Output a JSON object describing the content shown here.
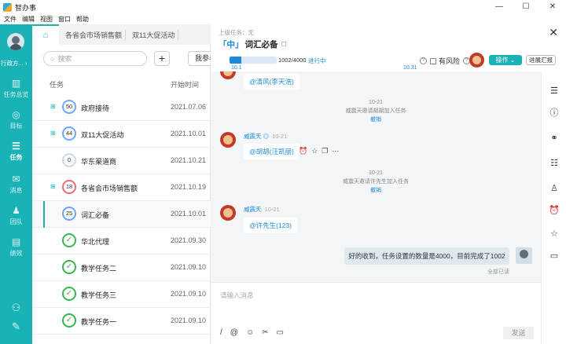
{
  "app": {
    "name": "智办事",
    "window_controls": [
      "—",
      "☐",
      "✕"
    ]
  },
  "menu": [
    "文件",
    "编辑",
    "视图",
    "窗口",
    "帮助"
  ],
  "user": {
    "name": "行政方..."
  },
  "nav": [
    {
      "label": "任务总览",
      "icon": "▥"
    },
    {
      "label": "目标",
      "icon": "◎"
    },
    {
      "label": "任务",
      "icon": "☰"
    },
    {
      "label": "消息",
      "icon": "✉"
    },
    {
      "label": "团队",
      "icon": "♟"
    },
    {
      "label": "绩效",
      "icon": "▤"
    }
  ],
  "nav_bottom": [
    {
      "icon": "⚇"
    },
    {
      "icon": "✎"
    }
  ],
  "tabs": [
    "各省会市场销售额",
    "双11大促活动"
  ],
  "search": {
    "placeholder": "搜索",
    "add": "+",
    "mine": "我参与"
  },
  "columns": {
    "task": "任务",
    "start": "开始时间"
  },
  "tasks": [
    {
      "name": "政府接待",
      "progress": "50",
      "date": "2021.07.06",
      "sub": true,
      "kind": "blue"
    },
    {
      "name": "双11大促活动",
      "progress": "44",
      "date": "2021.10.01",
      "sub": true,
      "kind": "blue"
    },
    {
      "name": "华东渠道商",
      "progress": "0",
      "date": "2021.10.21",
      "sub": false,
      "kind": "zero"
    },
    {
      "name": "各省会市场销售额",
      "progress": "18",
      "date": "2021.10.19",
      "sub": true,
      "kind": "red"
    },
    {
      "name": "词汇必备",
      "progress": "25",
      "date": "2021.10.01",
      "sub": false,
      "kind": "blue",
      "selected": true
    },
    {
      "name": "华北代理",
      "progress": "✓",
      "date": "2021.09.30",
      "sub": false,
      "kind": "done"
    },
    {
      "name": "教学任务二",
      "progress": "✓",
      "date": "2021.09.10",
      "sub": false,
      "kind": "done"
    },
    {
      "name": "教学任务三",
      "progress": "✓",
      "date": "2021.09.10",
      "sub": false,
      "kind": "done"
    },
    {
      "name": "教学任务一",
      "progress": "✓",
      "date": "2021.09.10",
      "sub": false,
      "kind": "done"
    }
  ],
  "detail": {
    "parent": "上级任务：无",
    "priority": "「中」",
    "title": "词汇必备",
    "progress_text": "1002/4000",
    "progress_value": 0.25,
    "status": "进行中",
    "start": "10.1",
    "end": "10.31",
    "risk": "有风险",
    "operate": "操作 ⌄",
    "report": "进展汇报"
  },
  "chat": {
    "m1": "@清风(李天浩)",
    "s1": {
      "date": "10-21",
      "text": "威震天邀请胡胡加入任务",
      "undo": "撤销"
    },
    "m2_name": "威震天 ◎",
    "m2_time": "10-21",
    "m2": "@胡胡(汪凯丽)",
    "m2_tools": "⏰☆❐⋯",
    "s2": {
      "date": "10-21",
      "text": "威震天邀请许先生加入任务",
      "undo": "撤销"
    },
    "m3_name": "威震天",
    "m3_time": "10-21",
    "m3": "@许先生(123)",
    "mine": "好的收到，任务设置的数量是4000，目前完成了1002",
    "read": "全部已读",
    "placeholder": "请输入消息",
    "tools": [
      "/",
      "@",
      "☺",
      "✂",
      "▭"
    ],
    "send": "发送"
  },
  "rail": [
    "☰",
    "ⓘ",
    "⚭",
    "☷",
    "♙",
    "⏰",
    "☆",
    "▭"
  ]
}
